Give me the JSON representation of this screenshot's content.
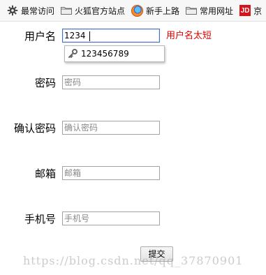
{
  "bookmarks": [
    {
      "label": "最常访问",
      "icon": "gear-icon"
    },
    {
      "label": "火狐官方站点",
      "icon": "folder-icon"
    },
    {
      "label": "新手上路",
      "icon": "firefox-icon"
    },
    {
      "label": "常用网址",
      "icon": "folder-icon"
    },
    {
      "label": "京",
      "icon": "jd-icon",
      "icon_text": "JD"
    }
  ],
  "form": {
    "username": {
      "label": "用户名",
      "value": "1234",
      "error": "用户名太短"
    },
    "autocomplete": {
      "suggestion": "123456789",
      "icon": "key-icon"
    },
    "password": {
      "label": "密码",
      "placeholder": "密码"
    },
    "confirm_password": {
      "label": "确认密码",
      "placeholder": "确认密码"
    },
    "email": {
      "label": "邮箱",
      "placeholder": "邮箱"
    },
    "phone": {
      "label": "手机号",
      "placeholder": "手机号"
    },
    "submit_label": "提交"
  },
  "watermark": "https://blog.csdn.net/qq_37870901",
  "colors": {
    "error": "#e00000",
    "focus_border": "#3b6fc9",
    "jd_brand": "#d7121b"
  }
}
